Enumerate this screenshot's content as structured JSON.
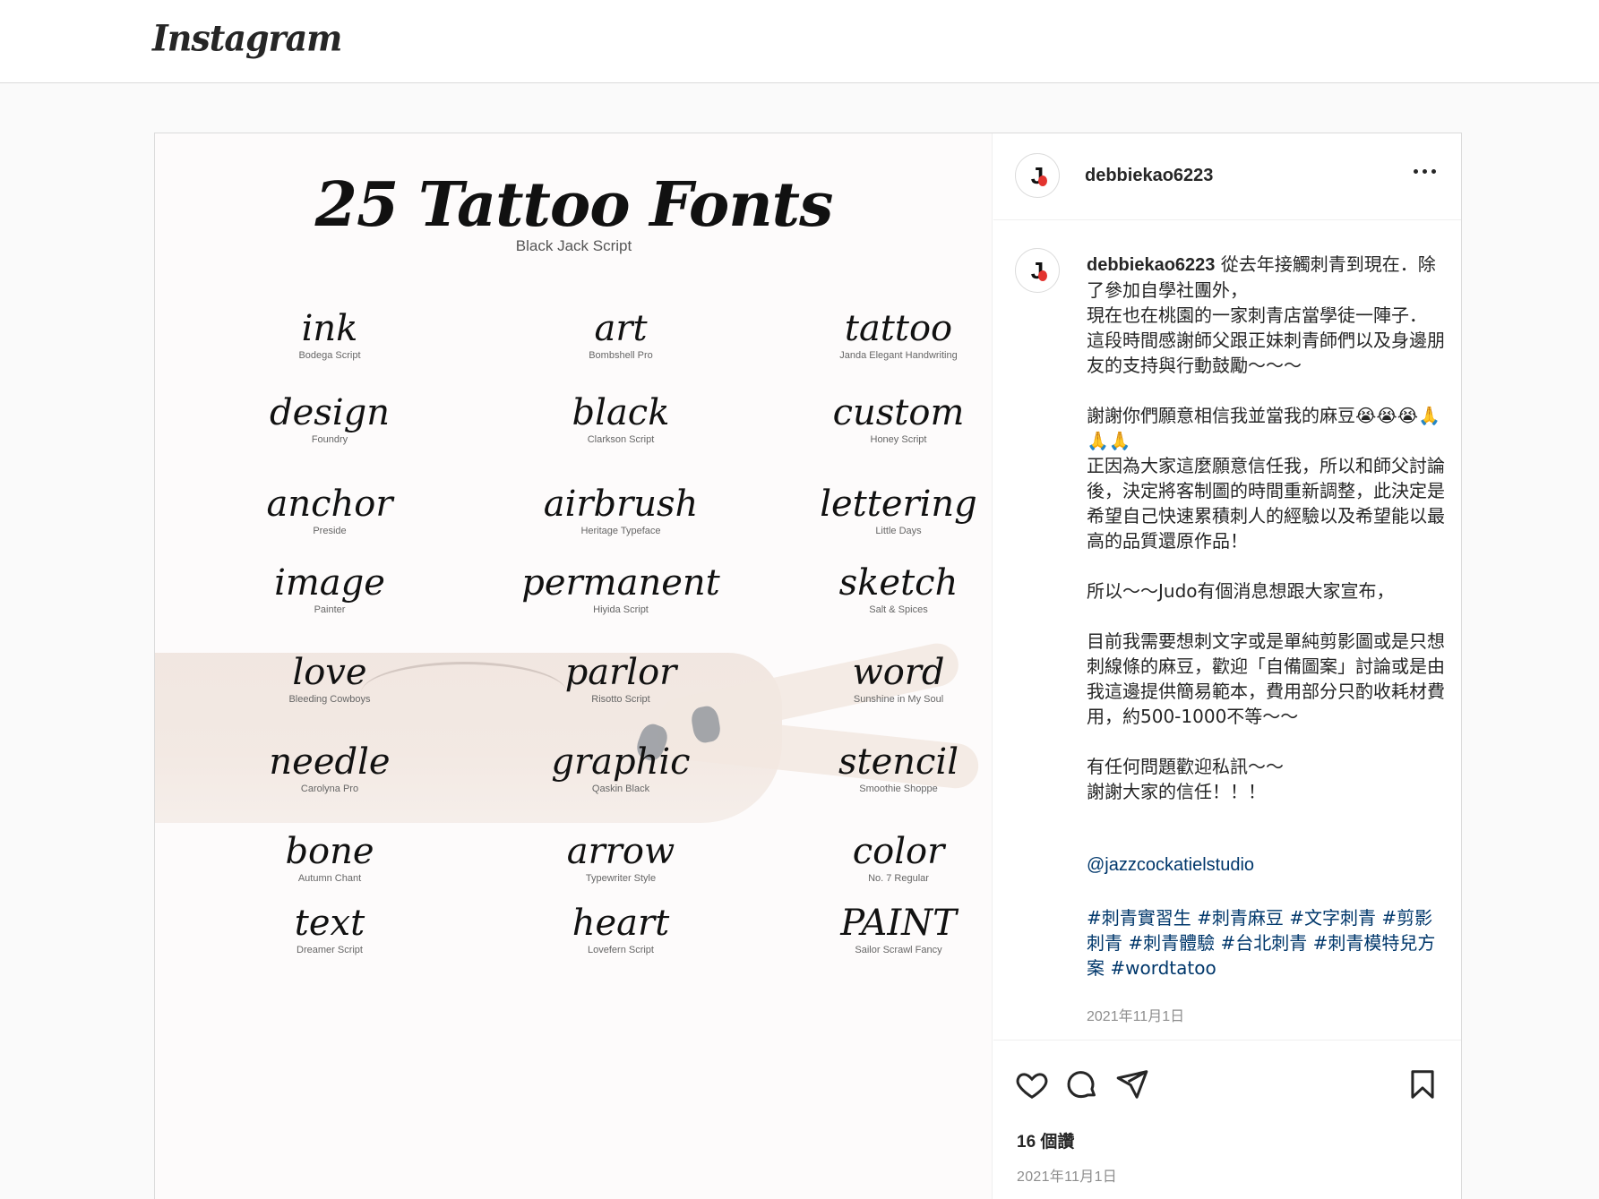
{
  "header": {
    "logo": "Instagram"
  },
  "media": {
    "title": "25 Tattoo Fonts",
    "subtitle": "Black Jack Script",
    "fonts": [
      {
        "word": "ink",
        "label": "Bodega Script"
      },
      {
        "word": "art",
        "label": "Bombshell Pro"
      },
      {
        "word": "tattoo",
        "label": "Janda Elegant Handwriting"
      },
      {
        "word": "design",
        "label": "Foundry"
      },
      {
        "word": "black",
        "label": "Clarkson Script"
      },
      {
        "word": "custom",
        "label": "Honey Script"
      },
      {
        "word": "anchor",
        "label": "Preside"
      },
      {
        "word": "airbrush",
        "label": "Heritage Typeface"
      },
      {
        "word": "lettering",
        "label": "Little Days"
      },
      {
        "word": "image",
        "label": "Painter"
      },
      {
        "word": "permanent",
        "label": "Hiyida Script"
      },
      {
        "word": "sketch",
        "label": "Salt & Spices"
      },
      {
        "word": "love",
        "label": "Bleeding Cowboys"
      },
      {
        "word": "parlor",
        "label": "Risotto Script"
      },
      {
        "word": "word",
        "label": "Sunshine in My Soul"
      },
      {
        "word": "needle",
        "label": "Carolyna Pro"
      },
      {
        "word": "graphic",
        "label": "Qaskin Black"
      },
      {
        "word": "stencil",
        "label": "Smoothie Shoppe"
      },
      {
        "word": "bone",
        "label": "Autumn Chant"
      },
      {
        "word": "arrow",
        "label": "Typewriter Style"
      },
      {
        "word": "color",
        "label": "No. 7 Regular"
      },
      {
        "word": "text",
        "label": "Dreamer Script"
      },
      {
        "word": "heart",
        "label": "Lovefern Script"
      },
      {
        "word": "PAINT",
        "label": "Sailor Scrawl Fancy"
      }
    ]
  },
  "post": {
    "username": "debbiekao6223",
    "avatar_glyph": "J",
    "caption_user": "debbiekao6223",
    "caption_body": " 從去年接觸刺青到現在．除了參加自學社團外，\n現在也在桃園的一家刺青店當學徒一陣子．\n這段時間感謝師父跟正妹刺青師們以及身邊朋友的支持與行動鼓勵～～～\n\n謝謝你們願意相信我並當我的麻豆😭😭😭🙏🙏🙏\n正因為大家這麼願意信任我，所以和師父討論後，決定將客制圖的時間重新調整，此決定是希望自己快速累積刺人的經驗以及希望能以最高的品質還原作品！\n\n所以～～Judo有個消息想跟大家宣布，\n\n目前我需要想刺文字或是單純剪影圖或是只想刺線條的麻豆，歡迎「自備圖案」討論或是由我這邊提供簡易範本，費用部分只酌收耗材費用，約500-1000不等～～\n\n有任何問題歡迎私訊～～\n謝謝大家的信任！！！",
    "mention": "@jazzcockatielstudio",
    "hashtags": "#刺青實習生 #刺青麻豆 #文字刺青 #剪影刺青 #刺青體驗 #台北刺青 #刺青模特兒方案 #wordtatoo",
    "caption_date": "2021年11月1日",
    "likes": "16 個讚",
    "date": "2021年11月1日"
  },
  "icons": [
    "heart-icon",
    "comment-icon",
    "share-icon",
    "bookmark-icon",
    "more-icon"
  ]
}
